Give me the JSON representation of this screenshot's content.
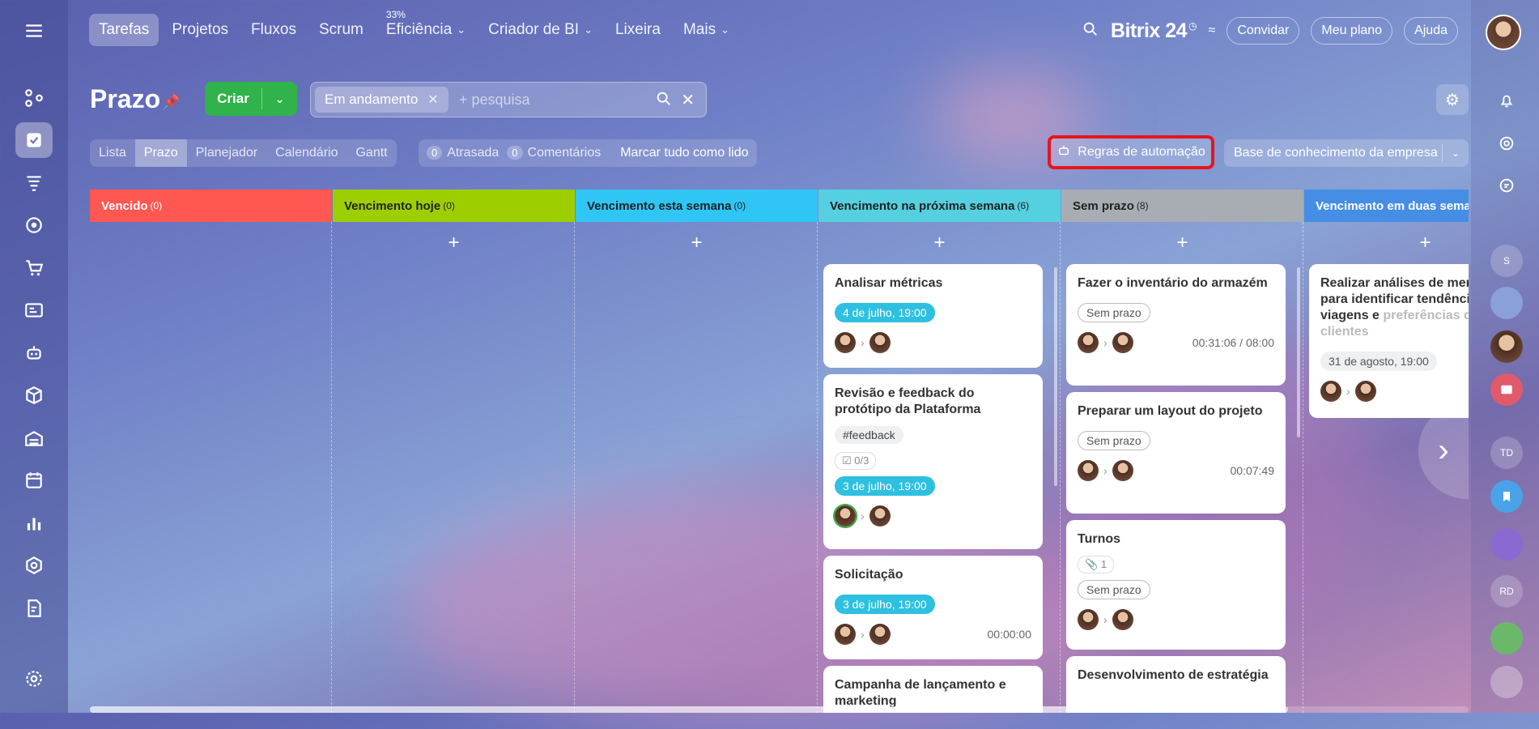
{
  "nav": {
    "tabs": [
      {
        "label": "Tarefas"
      },
      {
        "label": "Projetos"
      },
      {
        "label": "Fluxos"
      },
      {
        "label": "Scrum"
      },
      {
        "label": "Eficiência",
        "badge": "33%"
      },
      {
        "label": "Criador de BI"
      },
      {
        "label": "Lixeira"
      },
      {
        "label": "Mais"
      }
    ],
    "brand": "Bitrix 24",
    "invite": "Convidar",
    "plan": "Meu plano",
    "help": "Ajuda"
  },
  "header": {
    "title": "Prazo",
    "create": "Criar",
    "filter_chip": "Em andamento",
    "search_placeholder": "+ pesquisa"
  },
  "views": [
    "Lista",
    "Prazo",
    "Planejador",
    "Calendário",
    "Gantt"
  ],
  "counters": {
    "overdue_count": "0",
    "overdue_label": "Atrasada",
    "comments_count": "0",
    "comments_label": "Comentários",
    "mark_all": "Marcar tudo como lido"
  },
  "automation": "Regras de automação",
  "knowledge": "Base de conhecimento da empresa",
  "right_bar": {
    "s": "S",
    "td": "TD",
    "rd": "RD"
  },
  "columns": [
    {
      "title": "Vencido",
      "count": "(0)",
      "color": "#ff5752"
    },
    {
      "title": "Vencimento hoje",
      "count": "(0)",
      "color": "#9dcf00"
    },
    {
      "title": "Vencimento esta semana",
      "count": "(0)",
      "color": "#2fc6f6"
    },
    {
      "title": "Vencimento na próxima semana",
      "count": "(6)",
      "color": "#55d0e0"
    },
    {
      "title": "Sem prazo",
      "count": "(8)",
      "color": "#a8adb4"
    },
    {
      "title": "Vencimento em duas semanas",
      "count": "",
      "color": "#468ee5"
    }
  ],
  "cards": {
    "c1": {
      "title": "Analisar métricas",
      "date": "4 de julho, 19:00"
    },
    "c2": {
      "title": "Revisão e feedback do protótipo da Plataforma",
      "tag": "#feedback",
      "checklist": "0/3",
      "date": "3 de julho, 19:00"
    },
    "c3": {
      "title": "Solicitação",
      "date": "3 de julho, 19:00",
      "time": "00:00:00"
    },
    "c4": {
      "title": "Campanha de lançamento e marketing"
    },
    "d1": {
      "title": "Fazer o inventário do armazém",
      "badge": "Sem prazo",
      "time": "00:31:06 / 08:00"
    },
    "d2": {
      "title": "Preparar um layout do projeto",
      "badge": "Sem prazo",
      "time": "00:07:49"
    },
    "d3": {
      "title": "Turnos",
      "files": "1",
      "badge": "Sem prazo"
    },
    "d4": {
      "title": "Desenvolvimento de estratégia"
    },
    "e1": {
      "title1": "Realizar análises de mercado para identificar tendências de viagens e",
      "title2": "preferências dos clientes",
      "date": "31 de agosto, 19:00"
    }
  }
}
